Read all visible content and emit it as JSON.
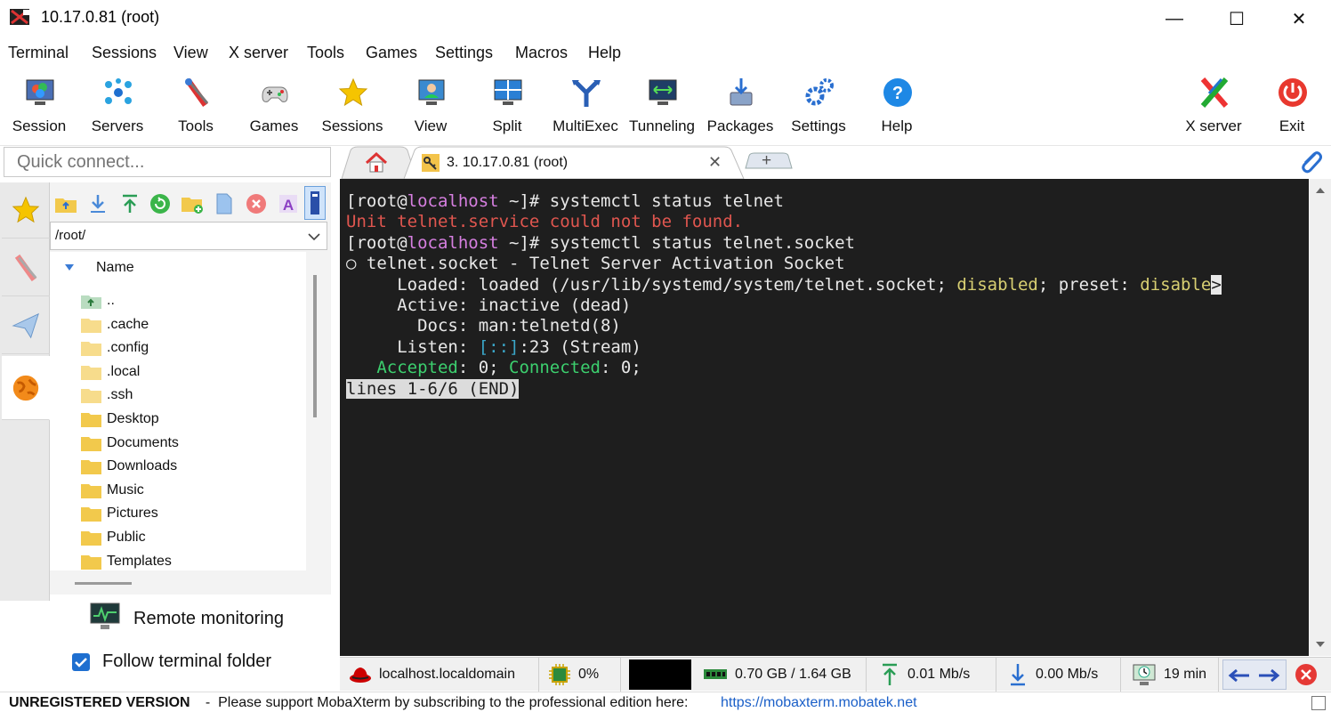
{
  "window": {
    "title": "10.17.0.81 (root)",
    "minimize_glyph": "—",
    "maximize_glyph": "☐",
    "close_glyph": "✕"
  },
  "menu": [
    "Terminal",
    "Sessions",
    "View",
    "X server",
    "Tools",
    "Games",
    "Settings",
    "Macros",
    "Help"
  ],
  "toolbar": [
    {
      "label": "Session",
      "icon": "session-icon"
    },
    {
      "label": "Servers",
      "icon": "servers-icon"
    },
    {
      "label": "Tools",
      "icon": "tools-icon"
    },
    {
      "label": "Games",
      "icon": "gamepad-icon"
    },
    {
      "label": "Sessions",
      "icon": "star-icon"
    },
    {
      "label": "View",
      "icon": "view-icon"
    },
    {
      "label": "Split",
      "icon": "split-icon"
    },
    {
      "label": "MultiExec",
      "icon": "multiexec-icon"
    },
    {
      "label": "Tunneling",
      "icon": "tunneling-icon"
    },
    {
      "label": "Packages",
      "icon": "packages-icon"
    },
    {
      "label": "Settings",
      "icon": "gears-icon"
    },
    {
      "label": "Help",
      "icon": "help-icon"
    },
    {
      "label": "X server",
      "icon": "xserver-icon"
    },
    {
      "label": "Exit",
      "icon": "power-icon"
    }
  ],
  "quick_connect": {
    "placeholder": "Quick connect..."
  },
  "tabs": {
    "active_label": "3. 10.17.0.81 (root)",
    "close_glyph": "✕",
    "new_tab_glyph": "+"
  },
  "sidebar": {
    "path": "/root/",
    "column_header": "Name",
    "files": [
      {
        "name": "..",
        "kind": "parent"
      },
      {
        "name": ".cache",
        "kind": "hidden-folder"
      },
      {
        "name": ".config",
        "kind": "hidden-folder"
      },
      {
        "name": ".local",
        "kind": "hidden-folder"
      },
      {
        "name": ".ssh",
        "kind": "hidden-folder"
      },
      {
        "name": "Desktop",
        "kind": "folder"
      },
      {
        "name": "Documents",
        "kind": "folder"
      },
      {
        "name": "Downloads",
        "kind": "folder"
      },
      {
        "name": "Music",
        "kind": "folder"
      },
      {
        "name": "Pictures",
        "kind": "folder"
      },
      {
        "name": "Public",
        "kind": "folder"
      },
      {
        "name": "Templates",
        "kind": "folder"
      }
    ],
    "remote_monitoring": "Remote monitoring",
    "follow_folder": "Follow terminal folder",
    "follow_checked": true
  },
  "terminal": {
    "lines": [
      [
        {
          "t": "[root@",
          "c": "#e8e8e8"
        },
        {
          "t": "localhost",
          "c": "#d67fe0"
        },
        {
          "t": " ~]# systemctl status telnet",
          "c": "#e8e8e8"
        }
      ],
      [
        {
          "t": "Unit telnet.service could not be found.",
          "c": "#e0564f"
        }
      ],
      [
        {
          "t": "[root@",
          "c": "#e8e8e8"
        },
        {
          "t": "localhost",
          "c": "#d67fe0"
        },
        {
          "t": " ~]# systemctl status telnet.socket",
          "c": "#e8e8e8"
        }
      ],
      [
        {
          "t": "○ telnet.socket - Telnet Server Activation Socket",
          "c": "#e8e8e8"
        }
      ],
      [
        {
          "t": "     Loaded: loaded (/usr/lib/systemd/system/telnet.socket; ",
          "c": "#e8e8e8"
        },
        {
          "t": "disabled",
          "c": "#d8cf72"
        },
        {
          "t": "; preset: ",
          "c": "#e8e8e8"
        },
        {
          "t": "disable",
          "c": "#d8cf72"
        },
        {
          "t": ">",
          "c": "#1e1e1e",
          "bg": "#e8e8e8"
        }
      ],
      [
        {
          "t": "     Active: inactive (dead)",
          "c": "#e8e8e8"
        }
      ],
      [
        {
          "t": "       Docs: man:telnetd(8)",
          "c": "#e8e8e8"
        }
      ],
      [
        {
          "t": "     Listen: ",
          "c": "#e8e8e8"
        },
        {
          "t": "[::]",
          "c": "#3aa6c8"
        },
        {
          "t": ":23 (Stream)",
          "c": "#e8e8e8"
        }
      ],
      [
        {
          "t": "   ",
          "c": "#e8e8e8"
        },
        {
          "t": "Accepted",
          "c": "#3ccf6e"
        },
        {
          "t": ": 0; ",
          "c": "#e8e8e8"
        },
        {
          "t": "Connected",
          "c": "#3ccf6e"
        },
        {
          "t": ": 0;",
          "c": "#e8e8e8"
        }
      ],
      [
        {
          "t": "lines 1-6/6 (END)",
          "c": "#1e1e1e",
          "bg": "#dcdcdc"
        }
      ]
    ]
  },
  "status": {
    "host": "localhost.localdomain",
    "cpu": "0%",
    "memory": "0.70 GB / 1.64 GB",
    "upload": "0.01 Mb/s",
    "download": "0.00 Mb/s",
    "uptime": "19 min"
  },
  "footer": {
    "unregistered": "UNREGISTERED VERSION",
    "message": "  -  Please support MobaXterm by subscribing to the professional edition here: ",
    "link": "https://mobaxterm.mobatek.net"
  }
}
